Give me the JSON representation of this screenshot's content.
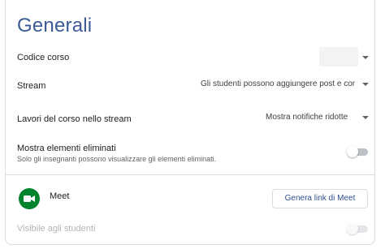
{
  "section": {
    "title": "Generali"
  },
  "course_code": {
    "label": "Codice corso"
  },
  "stream": {
    "label": "Stream",
    "selected": "Gli studenti possono aggiungere post e com"
  },
  "classwork": {
    "label": "Lavori del corso nello stream",
    "selected": "Mostra notifiche ridotte"
  },
  "deleted_items": {
    "label": "Mostra elementi eliminati",
    "description": "Solo gli insegnanti possono visualizzare gli elementi eliminati.",
    "enabled": false
  },
  "meet": {
    "label": "Meet",
    "button_label": "Genera link di Meet",
    "visibility_label": "Visibile agli studenti",
    "visibility_enabled": false
  },
  "colors": {
    "title": "#3c5a96",
    "meet_green": "#00832d",
    "meet_white": "#ffffff"
  },
  "icons": {
    "dropdown": "caret-down-icon",
    "meet": "meet-camera-icon"
  }
}
